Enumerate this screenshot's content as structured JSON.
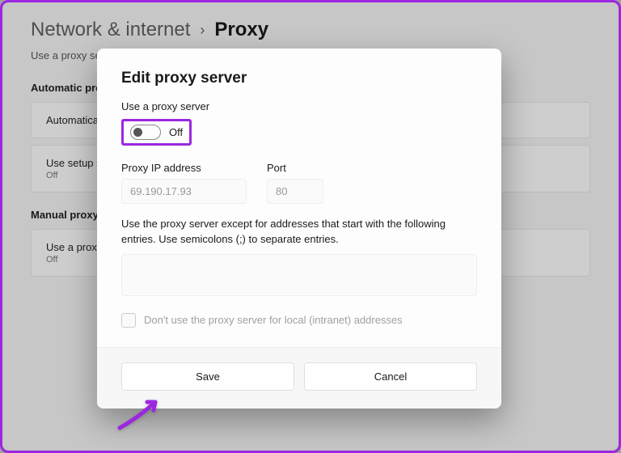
{
  "breadcrumb": {
    "parent": "Network & internet",
    "sep": "›",
    "current": "Proxy"
  },
  "bg": {
    "desc": "Use a proxy server for Ethernet or Wi-Fi connections. These settings don't apply to VPN connections.",
    "section_auto": "Automatic proxy setup",
    "card_auto": "Automatically detect settings",
    "card_script": {
      "title": "Use setup script",
      "sub": "Off"
    },
    "section_manual": "Manual proxy setup",
    "card_manual": {
      "title": "Use a proxy server",
      "sub": "Off"
    }
  },
  "dialog": {
    "title": "Edit proxy server",
    "toggle_label": "Use a proxy server",
    "toggle_state": "Off",
    "ip_label": "Proxy IP address",
    "ip_value": "69.190.17.93",
    "port_label": "Port",
    "port_value": "80",
    "exceptions_help": "Use the proxy server except for addresses that start with the following entries. Use semicolons (;) to separate entries.",
    "local_checkbox": "Don't use the proxy server for local (intranet) addresses",
    "save": "Save",
    "cancel": "Cancel"
  }
}
